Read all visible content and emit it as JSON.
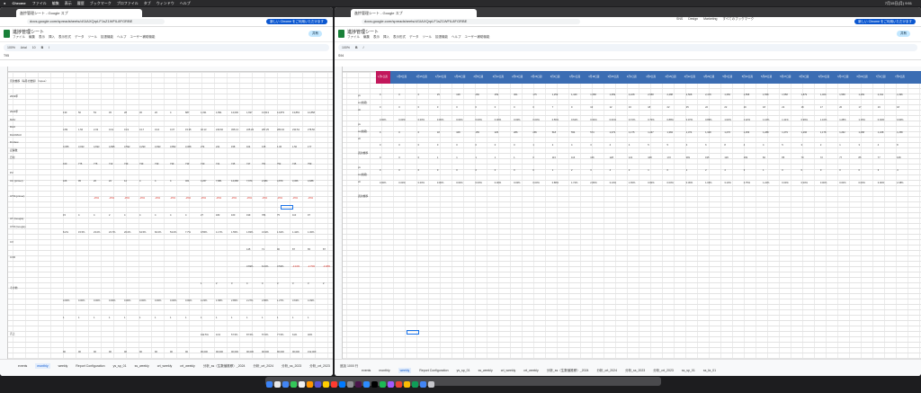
{
  "menubar": {
    "apple": "",
    "app": "Chrome",
    "items": [
      "ファイル",
      "編集",
      "表示",
      "履歴",
      "ブックマーク",
      "プロファイル",
      "タブ",
      "ウィンドウ",
      "ヘルプ"
    ],
    "clock": "7月15日(月) 9:51"
  },
  "left_window": {
    "tab_title": "進捗管理シート - Google スプ",
    "url": "docs.google.com/spreadsheets/d/1IAXQrpLF1sZ1WFIL8FGRBE",
    "update_label": "新しい Chrome をご利用いただけます",
    "doc_title": "進捗管理シート",
    "menus": [
      "ファイル",
      "編集",
      "表示",
      "挿入",
      "表示形式",
      "データ",
      "ツール",
      "拡張機能",
      "ヘルプ",
      "ユーザー補助機能"
    ],
    "share_label": "共有",
    "zoom": "100%",
    "font": "Arial",
    "font_size": "10",
    "cell_ref": "T95",
    "active_sheet": "monthly"
  },
  "right_window": {
    "tab_title": "進捗管理シート - Google スプ",
    "url": "docs.google.com/spreadsheets/d/1IAXQrpLF1sZ1WFIL8FGRBE",
    "update_label": "新しい Chrome をご利用いただけます",
    "bookmarks": [
      "SNS",
      "Design",
      "Marketing",
      "すべてのブックマーク"
    ],
    "doc_title": "進捗管理シート",
    "menus": [
      "ファイル",
      "編集",
      "表示",
      "挿入",
      "表示形式",
      "データ",
      "ツール",
      "拡張機能",
      "ヘルプ",
      "ユーザー補助機能"
    ],
    "share_label": "共有",
    "zoom": "100%",
    "cell_ref": "S94",
    "active_sheet": "weekly",
    "add_row_label": "追加",
    "row_count": "1000",
    "row_unit": "行"
  },
  "sheet_tabs": [
    "events",
    "monthly",
    "weekly",
    "Report Configuration",
    "ys_sp_01",
    "ss_weekly",
    "crt_weekly",
    "crt_weekly",
    "分析_ss（生数値推移）_2024",
    "分析_crt_2024",
    "分析_ss_2023",
    "分析_crt_2023",
    "ss_sp_01",
    "ss_fa_01"
  ],
  "left_row_labels": [
    "月次推移（毎月の数値）（rupee）",
    "",
    "2019年",
    "",
    "2022年",
    "MAU",
    "DAU",
    "DAU/MAU",
    "Dm3ew",
    "記事数",
    "日付",
    "",
    "PV",
    "UU (primer)",
    "",
    "CTR (primer)",
    "",
    "",
    "UT (Google)",
    "CTR (Google)",
    "",
    "CV",
    "",
    "CVR",
    "",
    "",
    "",
    "その他",
    "",
    "",
    "",
    "",
    "",
    "売上"
  ],
  "left_row_sublabels": [
    "合計",
    "前期",
    "昨年",
    "合計",
    "前期",
    "前年比",
    "合計",
    "前期",
    "前年比"
  ],
  "left_values": [
    [
      "130",
      "50",
      "53",
      "45",
      "28",
      "30",
      "20",
      "4",
      "887",
      "1,331",
      "1,891",
      "14,000",
      "1,697",
      "13,513",
      "14,879",
      "13,863",
      "12,858"
    ],
    [
      "4.89",
      "1.56",
      "2.33",
      "0.19",
      "0.19",
      "0.17",
      "0.16",
      "0.37",
      "15.35",
      "46.13",
      "249.66",
      "455.13",
      "225.29",
      "287.25",
      "280.04",
      "233.54",
      "278.50"
    ],
    [
      "3,355",
      "3,033",
      "4,693",
      "4,895",
      "3,592",
      "3,290",
      "3,093",
      "3,852",
      "3,308",
      "274",
      "241",
      "158",
      "104",
      "135",
      "1.36",
      "1.50",
      "177"
    ],
    [
      "160",
      "775",
      "775",
      "710",
      "739",
      "739",
      "739",
      "739",
      "739",
      "740",
      "741",
      "745",
      "747",
      "751",
      "752",
      "745",
      "759"
    ],
    [
      "106",
      "95",
      "26",
      "22",
      "12",
      "4",
      "4",
      "4",
      "461",
      "3,267",
      "7,881",
      "14,086",
      "7,979",
      "2,984",
      "4,879",
      "3,366",
      "4,688"
    ],
    [
      "",
      "",
      "-15%",
      "-15%",
      "-15%",
      "-15%",
      "-15%",
      "-15%",
      "-15%",
      "-15%",
      "-15%",
      "-15%",
      "-15%",
      "-15%",
      "-15%",
      "-15%",
      "-15%"
    ],
    [
      "15",
      "4",
      "4",
      "2",
      "4",
      "4",
      "4",
      "4",
      "4",
      "27",
      "182",
      "160",
      "199",
      "784",
      "75",
      "110",
      "97"
    ],
    [
      "8.2%",
      "15.5%",
      "23.0%",
      "23.7%",
      "20.0%",
      "64.5%",
      "60.0%",
      "53.0%",
      "7.7%",
      "9.55%",
      "1.17%",
      "1.55%",
      "1.83%",
      "3.19%",
      "1.62%",
      "1.42%",
      "1.30%"
    ],
    [
      "",
      "",
      "",
      "",
      "",
      "",
      "",
      "",
      "",
      "",
      "",
      "",
      "145",
      "71",
      "90",
      "87",
      "65",
      "87"
    ],
    [
      "",
      "",
      "",
      "",
      "",
      "",
      "",
      "",
      "",
      "",
      "",
      "",
      "3.69%",
      "6.10%",
      "3.53%",
      "-3.16%",
      "-2.75%",
      "-3.38%"
    ],
    [
      "",
      "",
      "",
      "",
      "",
      "",
      "",
      "",
      "",
      "1",
      "2",
      "3",
      "4",
      "4",
      "3",
      "3",
      "3",
      "2"
    ],
    [
      "0.00%",
      "0.00%",
      "0.00%",
      "0.00%",
      "0.00%",
      "0.00%",
      "0.00%",
      "0.00%",
      "0.00%",
      "2.23%",
      "1.58%",
      "2.85%",
      "2.27%",
      "2.85%",
      "1.27%",
      "3.63%",
      "4.39%"
    ],
    [
      "1",
      "1",
      "1",
      "1",
      "1",
      "1",
      "1",
      "1",
      "1",
      "1",
      "1",
      "1",
      "1",
      "1",
      "1",
      "1",
      "1"
    ],
    [
      "",
      "",
      "",
      "",
      "",
      "",
      "",
      "",
      "",
      "192.5%",
      "11%",
      "57.5%",
      "87.5%",
      "57.5%",
      "77.5%",
      "61%",
      "40%"
    ],
    [
      "90",
      "90",
      "90",
      "90",
      "90",
      "90",
      "90",
      "90",
      "90",
      "90,000",
      "90,000",
      "90,000",
      "90,000",
      "90,000",
      "90,000",
      "90,000",
      "¥12,000"
    ]
  ],
  "right_header_dates": [
    "1月1日週",
    "1月8日週",
    "1月15日週",
    "1月22日週",
    "1月29日週",
    "2月5日週",
    "2月12日週",
    "2月19日週",
    "2月26日週",
    "3月4日週",
    "3月11日週",
    "3月18日週",
    "3月25日週",
    "4月1日週",
    "4月8日週",
    "4月15日週",
    "4月22日週",
    "4月29日週",
    "5月6日週",
    "5月13日週",
    "5月20日週",
    "5月27日週",
    "6月3日週",
    "6月10日週",
    "6月17日週",
    "6月24日週",
    "7月1日週",
    "7月8日週"
  ],
  "right_row_labels": [
    "pv",
    "ss(前期)",
    "ctr",
    "",
    "pv",
    "ss(前期)",
    "ctr",
    "",
    "週次推移",
    "",
    "pv",
    "ss(前期)",
    "ctr",
    "",
    "週次推移"
  ],
  "right_values": [
    [
      "0",
      "0",
      "0",
      "25",
      "138",
      "266",
      "259",
      "361",
      "175",
      "1,259",
      "1,449",
      "1,558",
      "1,959",
      "2,228",
      "2,558",
      "2,488",
      "2,568",
      "2,478",
      "1,356",
      "1,558",
      "1,558",
      "1,558",
      "1,879",
      "1,469",
      "1,558",
      "1,469",
      "2,011",
      "1,996"
    ],
    [
      "0",
      "0",
      "0",
      "0",
      "0",
      "0",
      "0",
      "0",
      "0",
      "7",
      "9",
      "10",
      "12",
      "16",
      "18",
      "22",
      "25",
      "22",
      "22",
      "19",
      "18",
      "22",
      "18",
      "17",
      "20",
      "17",
      "19",
      "18"
    ],
    [
      "0.00%",
      "0.00%",
      "0.00%",
      "0.00%",
      "0.00%",
      "0.00%",
      "0.00%",
      "0.00%",
      "0.00%",
      "0.56%",
      "0.62%",
      "0.64%",
      "0.61%",
      "0.72%",
      "0.70%",
      "0.88%",
      "0.97%",
      "0.89%",
      "1.62%",
      "1.22%",
      "1.16%",
      "1.41%",
      "0.96%",
      "1.16%",
      "1.28%",
      "1.16%",
      "0.94%",
      "0.90%"
    ],
    [
      "0",
      "0",
      "0",
      "18",
      "168",
      "155",
      "225",
      "286",
      "265",
      "518",
      "554",
      "574",
      "1,073",
      "1,175",
      "1,237",
      "1,384",
      "1,374",
      "1,348",
      "1,276",
      "1,256",
      "1,288",
      "1,279",
      "1,266",
      "1,178",
      "1,262",
      "1,258",
      "1,248",
      "1,258"
    ],
    [
      "0",
      "0",
      "0",
      "0",
      "0",
      "0",
      "0",
      "0",
      "1",
      "2",
      "4",
      "3",
      "4",
      "4",
      "5",
      "5",
      "4",
      "6",
      "8",
      "4",
      "4",
      "5",
      "3",
      "2",
      "1",
      "3",
      "4",
      "8"
    ],
    [
      "0",
      "0",
      "0",
      "1",
      "1",
      "1",
      "1",
      "1",
      "0",
      "113",
      "116",
      "106",
      "128",
      "121",
      "168",
      "172",
      "281",
      "195",
      "129",
      "109",
      "82",
      "85",
      "79",
      "72",
      "77",
      "85",
      "77",
      "168"
    ],
    [
      "0",
      "0",
      "0",
      "0",
      "0",
      "0",
      "0",
      "0",
      "0",
      "1",
      "2",
      "3",
      "4",
      "2",
      "1",
      "0",
      "1",
      "2",
      "4",
      "3",
      "1",
      "0",
      "0",
      "0",
      "0",
      "0",
      "3",
      "4"
    ],
    [
      "0.00%",
      "0.00%",
      "0.00%",
      "0.00%",
      "0.00%",
      "0.00%",
      "0.00%",
      "0.00%",
      "0.00%",
      "0.88%",
      "1.72%",
      "2.83%",
      "3.13%",
      "1.65%",
      "0.60%",
      "0.00%",
      "0.36%",
      "1.03%",
      "3.10%",
      "2.75%",
      "1.22%",
      "0.00%",
      "0.00%",
      "0.00%",
      "0.00%",
      "0.00%",
      "3.90%",
      "2.38%"
    ]
  ],
  "colors": {
    "header_blue": "#3b6db3",
    "header_pink": "#c2185b",
    "accent": "#0b57d0",
    "sheet_bg": "#ffffff"
  }
}
